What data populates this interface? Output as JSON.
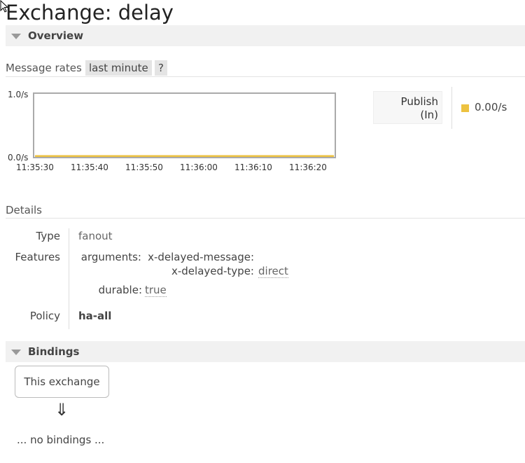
{
  "page": {
    "title": "Exchange: delay"
  },
  "overview": {
    "header": "Overview",
    "message_rates_label": "Message rates",
    "range_button": "last minute",
    "help_button": "?",
    "chart_data": {
      "type": "line",
      "x": [
        "11:35:30",
        "11:35:40",
        "11:35:50",
        "11:36:00",
        "11:36:10",
        "11:36:20"
      ],
      "series": [
        {
          "name": "Publish (In)",
          "values": [
            0,
            0,
            0,
            0,
            0,
            0
          ]
        }
      ],
      "y_ticks": [
        "1.0/s",
        "0.0/s"
      ],
      "ylim": [
        0,
        1
      ],
      "color": "#edc240"
    },
    "legend": {
      "label_line1": "Publish",
      "label_line2": "(In)",
      "value": "0.00/s"
    }
  },
  "details": {
    "header": "Details",
    "type_key": "Type",
    "type_value": "fanout",
    "features_key": "Features",
    "arguments_key": "arguments:",
    "arg1_key": "x-delayed-message:",
    "arg2_key": "x-delayed-type:",
    "arg2_value": "direct",
    "durable_key": "durable:",
    "durable_value": "true",
    "policy_key": "Policy",
    "policy_value": "ha-all"
  },
  "bindings": {
    "header": "Bindings",
    "this_exchange": "This exchange",
    "arrow": "⇓",
    "empty": "... no bindings ..."
  }
}
